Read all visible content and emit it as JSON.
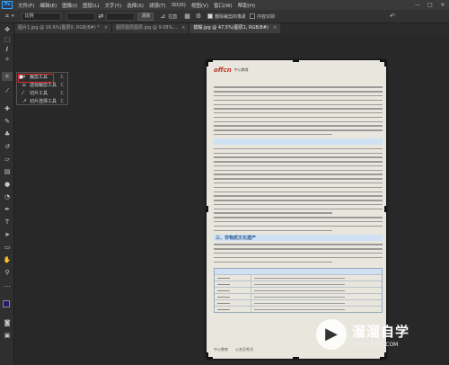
{
  "menubar": {
    "logo": "Ps",
    "items": [
      "文件(F)",
      "编辑(E)",
      "图像(I)",
      "图层(L)",
      "文字(Y)",
      "选择(S)",
      "滤镜(T)",
      "3D(D)",
      "视图(V)",
      "窗口(W)",
      "帮助(H)"
    ],
    "window_controls": [
      "—",
      "□",
      "✕"
    ]
  },
  "options": {
    "ratio_value": "比例",
    "clear_label": "清除",
    "straighten_label": "拉直",
    "delete_pixels_label": "删除裁剪的像素",
    "content_aware_label": "内容识别"
  },
  "tabs": [
    {
      "label": "图片1.jpg @ 16.6%(图层0, RGB/8#) *",
      "active": false
    },
    {
      "label": "图层图层图层.jpg @ 9.08%...",
      "active": false
    },
    {
      "label": "模糊.jpg @ 47.5%(图层1, RGB/8#)",
      "active": true
    }
  ],
  "flyout": {
    "items": [
      {
        "label": "裁剪工具",
        "key": "C",
        "icon": "crop-icon"
      },
      {
        "label": "透视裁剪工具",
        "key": "C",
        "icon": "perspective-crop-icon"
      },
      {
        "label": "切片工具",
        "key": "C",
        "icon": "slice-icon"
      },
      {
        "label": "切片选择工具",
        "key": "C",
        "icon": "slice-select-icon"
      }
    ]
  },
  "document": {
    "brand": "offcn",
    "brand_sub": "中公教育",
    "headings": [
      "三、非物质文化遗产"
    ],
    "footer_left": "中公教育",
    "footer_mid": "公务员考试"
  },
  "watermark": {
    "title": "溜溜自学",
    "url": "ZIXUE.3066.COM"
  },
  "colors": {
    "highlight": "#e0242b",
    "accent": "#31a8ff"
  }
}
